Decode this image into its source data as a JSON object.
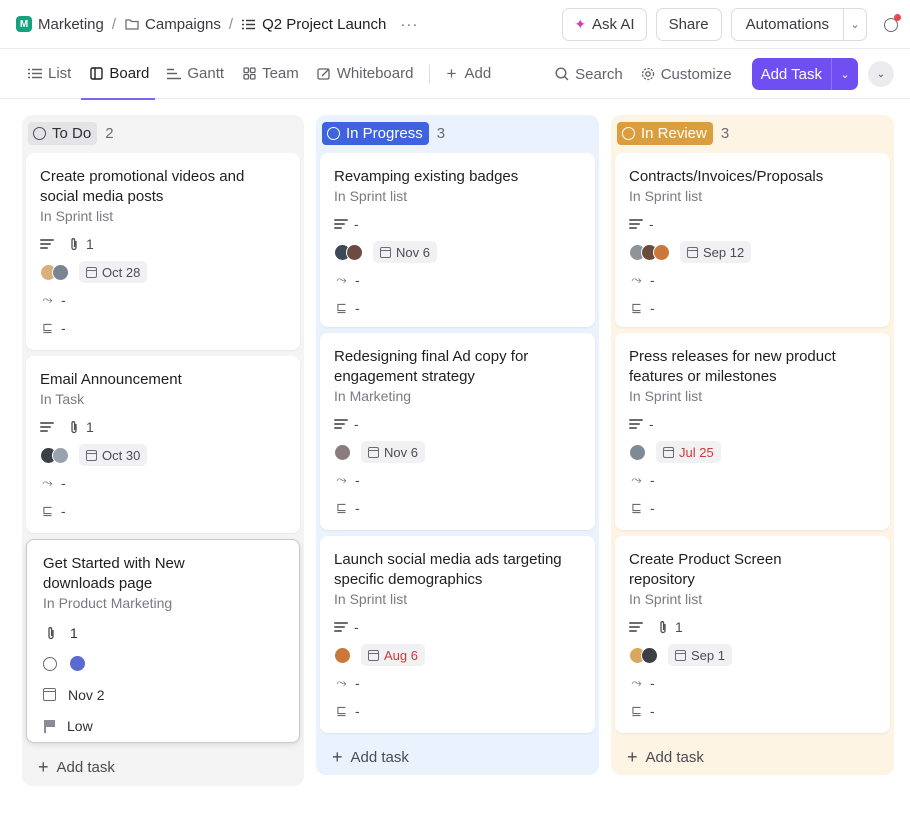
{
  "breadcrumb": {
    "space_initial": "M",
    "items": [
      "Marketing",
      "Campaigns",
      "Q2 Project Launch"
    ],
    "more": "···"
  },
  "topbar": {
    "ask_ai": "Ask AI",
    "share": "Share",
    "automations": "Automations"
  },
  "views": [
    "List",
    "Board",
    "Gantt",
    "Team",
    "Whiteboard",
    "Add"
  ],
  "toolbar": {
    "search": "Search",
    "customize": "Customize",
    "add_task": "Add Task"
  },
  "columns": [
    {
      "status": "To Do",
      "count": "2",
      "color": "#e4e4e7",
      "cards": [
        {
          "title": "Create promotional videos and social media posts",
          "list": "In Sprint list",
          "attachments": "1",
          "date": "Oct 28",
          "dash1": "-",
          "dash2": "-"
        },
        {
          "title": "Email Announcement",
          "list": "In Task",
          "attachments": "1",
          "date": "Oct 30",
          "dash1": "-",
          "dash2": "-"
        },
        {
          "title": "Get Started with New downloads page",
          "list": "In Product Marketing",
          "attachments": "1",
          "date": "Nov 2",
          "priority": "Low"
        }
      ],
      "add_task": "Add task"
    },
    {
      "status": "In Progress",
      "count": "3",
      "color": "#3f63df",
      "cards": [
        {
          "title": "Revamping existing badges",
          "list": "In Sprint list",
          "desc": "-",
          "date": "Nov 6",
          "dash1": "-",
          "dash2": "-"
        },
        {
          "title": "Redesigning final Ad copy for engagement strategy",
          "list": "In Marketing",
          "desc": "-",
          "date": "Nov 6",
          "dash1": "-",
          "dash2": "-"
        },
        {
          "title": "Launch social media ads targeting specific demographics",
          "list": "In Sprint list",
          "desc": "-",
          "date": "Aug 6",
          "dash1": "-",
          "dash2": "-"
        }
      ],
      "add_task": "Add task"
    },
    {
      "status": "In Review",
      "count": "3",
      "color": "#db9e3e",
      "cards": [
        {
          "title": "Contracts/Invoices/Proposals",
          "list": "In Sprint list",
          "desc": "-",
          "date": "Sep 12",
          "dash1": "-",
          "dash2": "-"
        },
        {
          "title": "Press releases for new product features or milestones",
          "list": "In Sprint list",
          "desc": "-",
          "date": "Jul 25",
          "dash1": "-",
          "dash2": "-"
        },
        {
          "title": "Create Product Screen repository",
          "list": "In Sprint list",
          "attachments": "1",
          "date": "Sep 1",
          "dash1": "-",
          "dash2": "-"
        }
      ],
      "add_task": "Add task"
    }
  ]
}
